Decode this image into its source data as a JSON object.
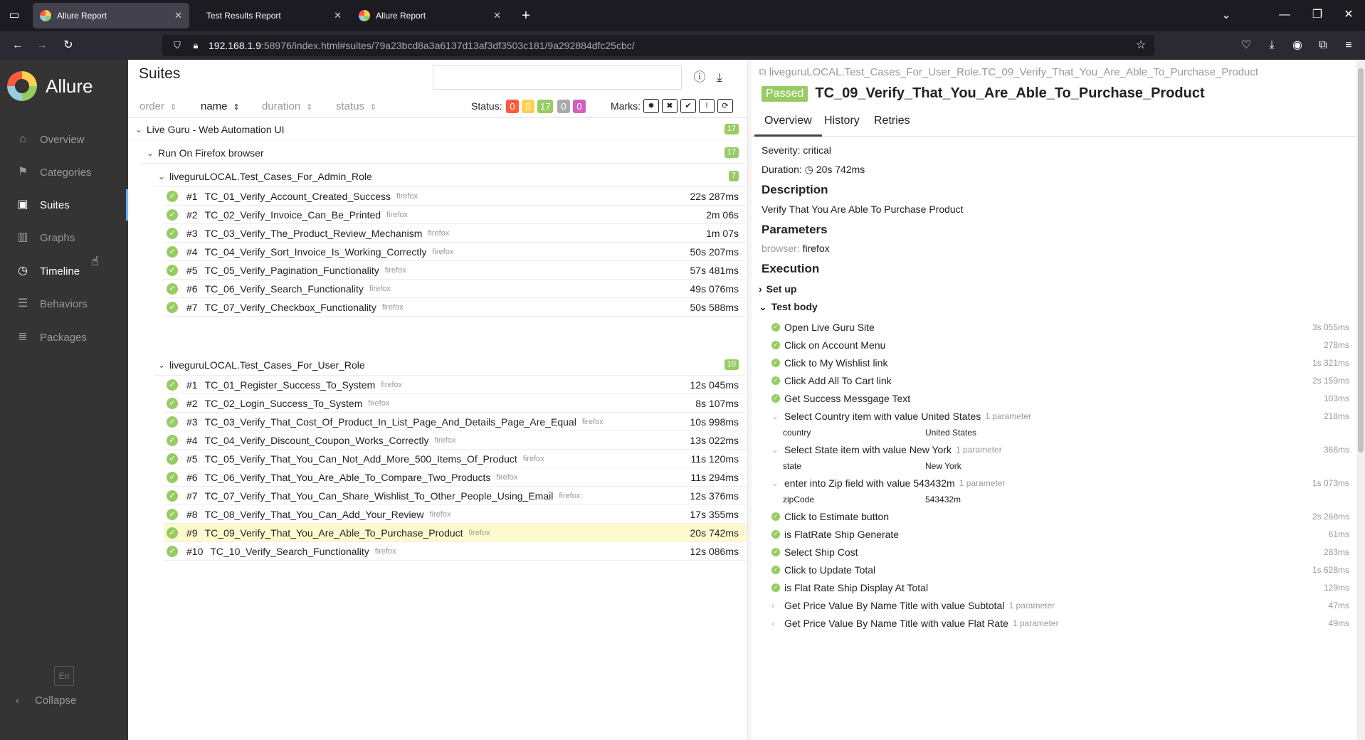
{
  "browser": {
    "tabs": [
      {
        "title": "Allure Report",
        "active": true
      },
      {
        "title": "Test Results Report",
        "active": false
      },
      {
        "title": "Allure Report",
        "active": false
      }
    ],
    "url_host": "192.168.1.9",
    "url_rest": ":58976/index.html#suites/79a23bcd8a3a6137d13af3df3503c181/9a292884dfc25cbc/"
  },
  "sidebar": {
    "brand": "Allure",
    "items": [
      {
        "label": "Overview",
        "icon": "home-icon"
      },
      {
        "label": "Categories",
        "icon": "flag-icon"
      },
      {
        "label": "Suites",
        "icon": "briefcase-icon"
      },
      {
        "label": "Graphs",
        "icon": "bar-chart-icon"
      },
      {
        "label": "Timeline",
        "icon": "clock-icon"
      },
      {
        "label": "Behaviors",
        "icon": "list-icon"
      },
      {
        "label": "Packages",
        "icon": "align-left-icon"
      }
    ],
    "language": "En",
    "collapse": "Collapse"
  },
  "suites": {
    "title": "Suites",
    "sort": {
      "order": "order",
      "name": "name",
      "duration": "duration",
      "status": "status"
    },
    "status_label": "Status:",
    "status_counts": [
      {
        "value": "0",
        "color": "#fd5a3e"
      },
      {
        "value": "0",
        "color": "#ffd050"
      },
      {
        "value": "17",
        "color": "#97cc64"
      },
      {
        "value": "0",
        "color": "#aaaaaa"
      },
      {
        "value": "0",
        "color": "#d35ebe"
      }
    ],
    "marks_label": "Marks:",
    "root": {
      "name": "Live Guru - Web Automation UI",
      "count": "17"
    },
    "browser_group": {
      "name": "Run On Firefox browser",
      "count": "17"
    },
    "groups": [
      {
        "name": "liveguruLOCAL.Test_Cases_For_Admin_Role",
        "count": "7",
        "tests": [
          {
            "num": "#1",
            "name": "TC_01_Verify_Account_Created_Success",
            "tag": "firefox",
            "dur": "22s 287ms"
          },
          {
            "num": "#2",
            "name": "TC_02_Verify_Invoice_Can_Be_Printed",
            "tag": "firefox",
            "dur": "2m 06s"
          },
          {
            "num": "#3",
            "name": "TC_03_Verify_The_Product_Review_Mechanism",
            "tag": "firefox",
            "dur": "1m 07s"
          },
          {
            "num": "#4",
            "name": "TC_04_Verify_Sort_Invoice_Is_Working_Correctly",
            "tag": "firefox",
            "dur": "50s 207ms"
          },
          {
            "num": "#5",
            "name": "TC_05_Verify_Pagination_Functionality",
            "tag": "firefox",
            "dur": "57s 481ms"
          },
          {
            "num": "#6",
            "name": "TC_06_Verify_Search_Functionality",
            "tag": "firefox",
            "dur": "49s 076ms"
          },
          {
            "num": "#7",
            "name": "TC_07_Verify_Checkbox_Functionality",
            "tag": "firefox",
            "dur": "50s 588ms"
          }
        ]
      },
      {
        "name": "liveguruLOCAL.Test_Cases_For_User_Role",
        "count": "10",
        "tests": [
          {
            "num": "#1",
            "name": "TC_01_Register_Success_To_System",
            "tag": "firefox",
            "dur": "12s 045ms"
          },
          {
            "num": "#2",
            "name": "TC_02_Login_Success_To_System",
            "tag": "firefox",
            "dur": "8s 107ms"
          },
          {
            "num": "#3",
            "name": "TC_03_Verify_That_Cost_Of_Product_In_List_Page_And_Details_Page_Are_Equal",
            "tag": "firefox",
            "dur": "10s 998ms"
          },
          {
            "num": "#4",
            "name": "TC_04_Verify_Discount_Coupon_Works_Correctly",
            "tag": "firefox",
            "dur": "13s 022ms"
          },
          {
            "num": "#5",
            "name": "TC_05_Verify_That_You_Can_Not_Add_More_500_Items_Of_Product",
            "tag": "firefox",
            "dur": "11s 120ms"
          },
          {
            "num": "#6",
            "name": "TC_06_Verify_That_You_Are_Able_To_Compare_Two_Products",
            "tag": "firefox",
            "dur": "11s 294ms"
          },
          {
            "num": "#7",
            "name": "TC_07_Verify_That_You_Can_Share_Wishlist_To_Other_People_Using_Email",
            "tag": "firefox",
            "dur": "12s 376ms"
          },
          {
            "num": "#8",
            "name": "TC_08_Verify_That_You_Can_Add_Your_Review",
            "tag": "firefox",
            "dur": "17s 355ms"
          },
          {
            "num": "#9",
            "name": "TC_09_Verify_That_You_Are_Able_To_Purchase_Product",
            "tag": "firefox",
            "dur": "20s 742ms",
            "selected": true
          },
          {
            "num": "#10",
            "name": "TC_10_Verify_Search_Functionality",
            "tag": "firefox",
            "dur": "12s 086ms"
          }
        ]
      }
    ]
  },
  "detail": {
    "breadcrumb": "liveguruLOCAL.Test_Cases_For_User_Role.TC_09_Verify_That_You_Are_Able_To_Purchase_Product",
    "status": "Passed",
    "title": "TC_09_Verify_That_You_Are_Able_To_Purchase_Product",
    "tabs": [
      "Overview",
      "History",
      "Retries"
    ],
    "severity_label": "Severity:",
    "severity": "critical",
    "duration_label": "Duration:",
    "duration": "20s 742ms",
    "description_heading": "Description",
    "description": "Verify That You Are Able To Purchase Product",
    "parameters_heading": "Parameters",
    "param_key": "browser:",
    "param_value": "firefox",
    "execution_heading": "Execution",
    "setup_label": "Set up",
    "testbody_label": "Test body",
    "steps": [
      {
        "name": "Open Live Guru Site",
        "dur": "3s 055ms"
      },
      {
        "name": "Click on Account Menu",
        "dur": "278ms"
      },
      {
        "name": "Click to My Wishlist link",
        "dur": "1s 321ms"
      },
      {
        "name": "Click Add All To Cart link",
        "dur": "2s 159ms"
      },
      {
        "name": "Get Success Messgage Text",
        "dur": "103ms"
      },
      {
        "name": "Select Country item with value United States",
        "dur": "218ms",
        "params": "1 parameter",
        "pkey": "country",
        "pval": "United States"
      },
      {
        "name": "Select State item with value New York",
        "dur": "366ms",
        "params": "1 parameter",
        "pkey": "state",
        "pval": "New York"
      },
      {
        "name": "enter into Zip field with value 543432m",
        "dur": "1s 073ms",
        "params": "1 parameter",
        "pkey": "zipCode",
        "pval": "543432m"
      },
      {
        "name": "Click to Estimate button",
        "dur": "2s 268ms"
      },
      {
        "name": "is FlatRate Ship Generate",
        "dur": "61ms"
      },
      {
        "name": "Select Ship Cost",
        "dur": "283ms"
      },
      {
        "name": "Click to Update Total",
        "dur": "1s 628ms"
      },
      {
        "name": "is Flat Rate Ship Display At Total",
        "dur": "129ms"
      },
      {
        "name": "Get Price Value By Name Title with value Subtotal",
        "dur": "47ms",
        "params": "1 parameter",
        "collapsed": true
      },
      {
        "name": "Get Price Value By Name Title with value Flat Rate",
        "dur": "49ms",
        "params": "1 parameter",
        "collapsed": true
      }
    ]
  }
}
